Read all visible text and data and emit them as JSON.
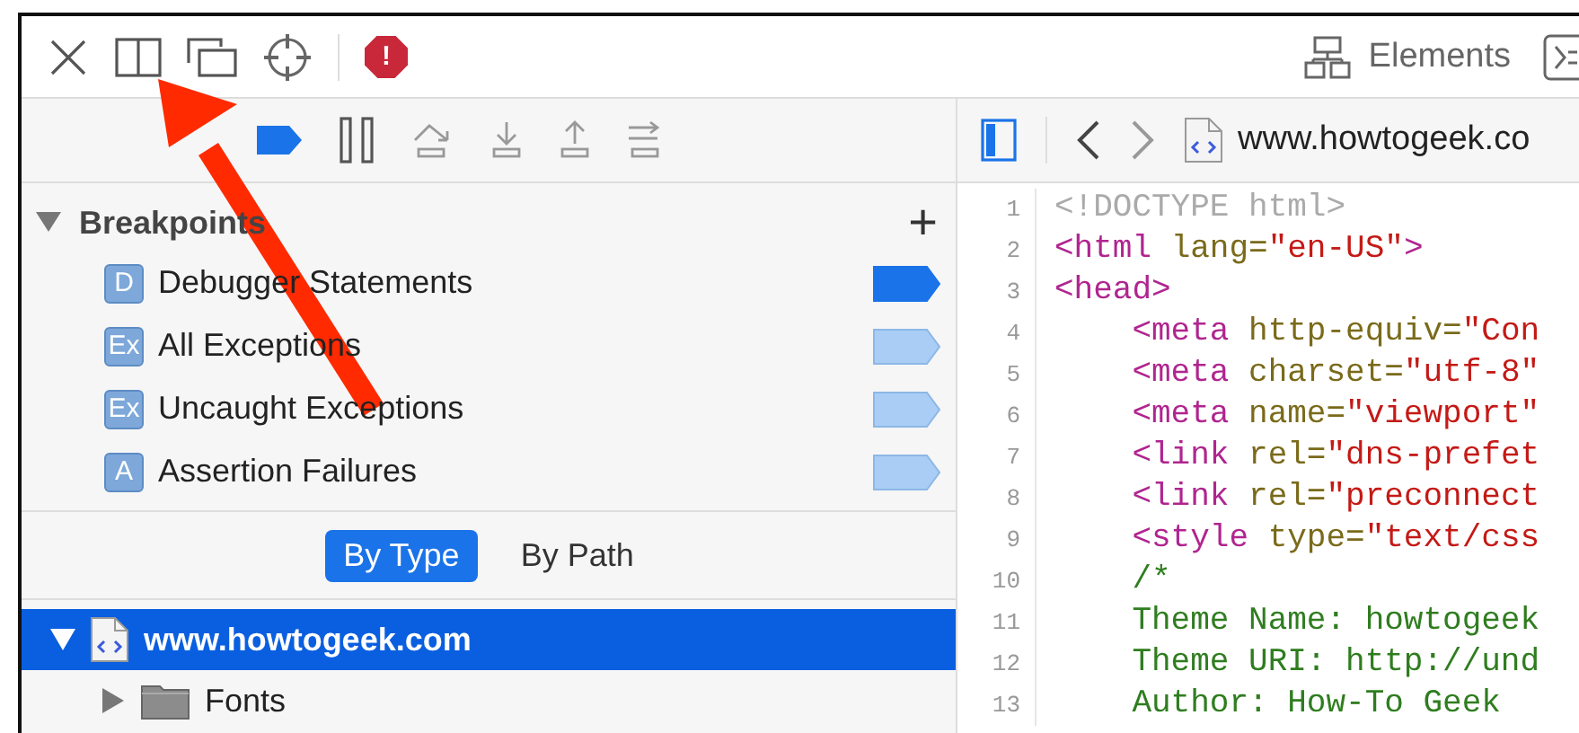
{
  "toolbar": {
    "error_badge": "!",
    "tabs": [
      {
        "label": "Elements",
        "selected": false
      }
    ]
  },
  "debugger_toolbar": {
    "breakpoints_active": true
  },
  "breakpoints": {
    "title": "Breakpoints",
    "expanded": true,
    "add": "+",
    "items": [
      {
        "icon": "D",
        "label": "Debugger Statements",
        "enabled": true
      },
      {
        "icon": "Ex",
        "label": "All Exceptions",
        "enabled": false
      },
      {
        "icon": "Ex",
        "label": "Uncaught Exceptions",
        "enabled": false
      },
      {
        "icon": "A",
        "label": "Assertion Failures",
        "enabled": false
      }
    ]
  },
  "grouping": [
    {
      "label": "By Type",
      "selected": true
    },
    {
      "label": "By Path",
      "selected": false
    }
  ],
  "tree": [
    {
      "label": "www.howtogeek.com",
      "kind": "document",
      "selected": true,
      "expanded": true,
      "children": [
        {
          "label": "Fonts",
          "kind": "folder",
          "selected": false,
          "expanded": false
        }
      ]
    }
  ],
  "source": {
    "navigator_shown": true,
    "file": "www.howtogeek.co",
    "lines": [
      {
        "number": "1",
        "indented": false,
        "tokens": [
          {
            "kind": "doctype",
            "text": "<!DOCTYPE html>"
          }
        ]
      },
      {
        "number": "2",
        "indented": false,
        "tokens": [
          {
            "kind": "tag",
            "text": "<html"
          },
          {
            "kind": "attr",
            "text": " lang="
          },
          {
            "kind": "string",
            "text": "\"en-US\""
          },
          {
            "kind": "tag",
            "text": ">"
          }
        ]
      },
      {
        "number": "3",
        "indented": false,
        "tokens": [
          {
            "kind": "tag",
            "text": "<head>"
          }
        ]
      },
      {
        "number": "4",
        "indented": true,
        "tokens": [
          {
            "kind": "tag",
            "text": "<meta"
          },
          {
            "kind": "attr",
            "text": " http-equiv="
          },
          {
            "kind": "string",
            "text": "\"Con"
          }
        ]
      },
      {
        "number": "5",
        "indented": true,
        "tokens": [
          {
            "kind": "tag",
            "text": "<meta"
          },
          {
            "kind": "attr",
            "text": " charset="
          },
          {
            "kind": "string",
            "text": "\"utf-8\""
          }
        ]
      },
      {
        "number": "6",
        "indented": true,
        "tokens": [
          {
            "kind": "tag",
            "text": "<meta"
          },
          {
            "kind": "attr",
            "text": " name="
          },
          {
            "kind": "string",
            "text": "\"viewport\""
          }
        ]
      },
      {
        "number": "7",
        "indented": true,
        "tokens": [
          {
            "kind": "tag",
            "text": "<link"
          },
          {
            "kind": "attr",
            "text": " rel="
          },
          {
            "kind": "string",
            "text": "\"dns-prefet"
          }
        ]
      },
      {
        "number": "8",
        "indented": true,
        "tokens": [
          {
            "kind": "tag",
            "text": "<link"
          },
          {
            "kind": "attr",
            "text": " rel="
          },
          {
            "kind": "string",
            "text": "\"preconnect"
          }
        ]
      },
      {
        "number": "9",
        "indented": true,
        "tokens": [
          {
            "kind": "tag",
            "text": "<style"
          },
          {
            "kind": "attr",
            "text": " type="
          },
          {
            "kind": "string",
            "text": "\"text/css"
          }
        ]
      },
      {
        "number": "10",
        "indented": true,
        "tokens": [
          {
            "kind": "comment",
            "text": "/*"
          }
        ]
      },
      {
        "number": "11",
        "indented": true,
        "tokens": [
          {
            "kind": "comment",
            "text": "Theme Name: howtogeek"
          }
        ]
      },
      {
        "number": "12",
        "indented": true,
        "tokens": [
          {
            "kind": "comment",
            "text": "Theme URI: http://und"
          }
        ]
      },
      {
        "number": "13",
        "indented": true,
        "tokens": [
          {
            "kind": "comment",
            "text": "Author: How-To Geek"
          }
        ]
      }
    ]
  }
}
